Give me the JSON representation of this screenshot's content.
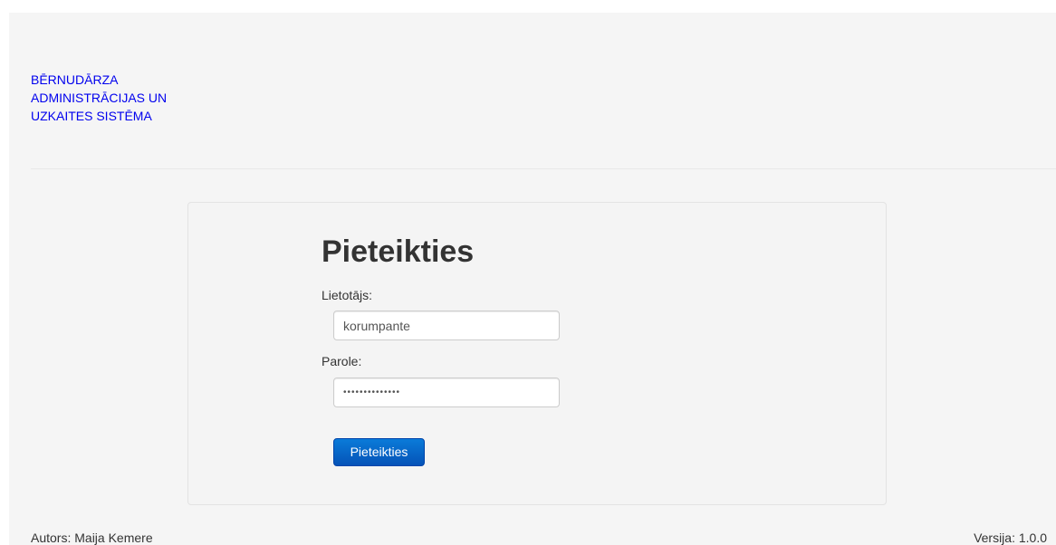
{
  "header": {
    "brand_lines": [
      "BĒRNUDĀRZA",
      "ADMINISTRĀCIJAS UN",
      "UZKAITES SISTĒMA"
    ],
    "brand_color": "#0000ee"
  },
  "login": {
    "title": "Pieteikties",
    "username_label": "Lietotājs:",
    "username_value": "korumpante",
    "password_label": "Parole:",
    "password_value": "••••••••••••••",
    "submit_label": "Pieteikties",
    "button_color": "#0a6fd0"
  },
  "footer": {
    "author": "Autors: Maija Kemere",
    "version": "Versija: 1.0.0"
  }
}
